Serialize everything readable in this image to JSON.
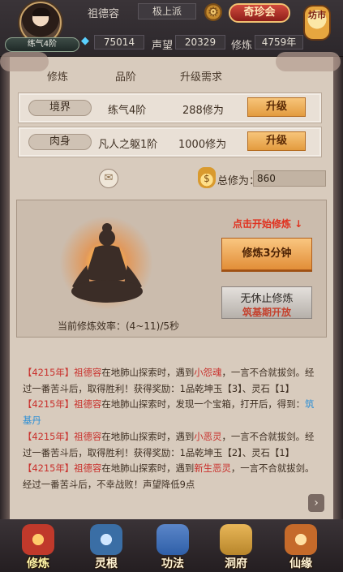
{
  "header": {
    "player_name": "祖德容",
    "sect": "极上派",
    "realm_badge": "练气4阶",
    "treasure_button": "奇珍会",
    "market_button": "坊市",
    "spirit_stones": "75014",
    "reputation_label": "声望",
    "reputation_value": "20329",
    "cultivation_label": "修炼",
    "cultivation_years": "4759年",
    "icons": {
      "settings": "gear-icon",
      "currency": "diamond-icon"
    }
  },
  "table": {
    "headers": [
      "修炼",
      "品阶",
      "升级需求"
    ],
    "rows": [
      {
        "label": "境界",
        "grade": "练气4阶",
        "requirement": "288修为",
        "button": "升级"
      },
      {
        "label": "肉身",
        "grade": "凡人之躯1阶",
        "requirement": "1000修为",
        "button": "升级"
      }
    ]
  },
  "total": {
    "label": "总修为：",
    "value": "860"
  },
  "stage": {
    "click_hint": "点击开始修炼 ↓",
    "cultivate_button": "修炼3分钟",
    "endless_button": "无休止修炼",
    "endless_note": "筑基期开放",
    "efficiency": "当前修炼效率：(4~11)/5秒"
  },
  "log": [
    {
      "year": "【4215年】",
      "name": "祖德容",
      "text1": "在地肺山探索时，遇到",
      "foe": "小怨魂",
      "text2": "，一言不合就拔剑。经过一番苦斗后，取得胜利！获得奖励：1品乾坤玉【3】、灵石【1】"
    },
    {
      "year": "【4215年】",
      "name": "祖德容",
      "text1": "在地肺山探索时，发现一个宝箱，打开后，得到：",
      "foe": "筑基丹",
      "text2": ""
    },
    {
      "year": "【4215年】",
      "name": "祖德容",
      "text1": "在地肺山探索时，遇到",
      "foe": "小恶灵",
      "text2": "，一言不合就拔剑。经过一番苦斗后，取得胜利！获得奖励：1品乾坤玉【2】、灵石【1】"
    },
    {
      "year": "【4215年】",
      "name": "祖德容",
      "text1": "在地肺山探索时，遇到",
      "foe": "新生恶灵",
      "text2": "，一言不合就拔剑。经过一番苦斗后，不幸战败！声望降低9点"
    }
  ],
  "nav": [
    {
      "label": "修炼",
      "icon": "cultivation-icon",
      "color": "#c0392b"
    },
    {
      "label": "灵根",
      "icon": "spirit-root-icon",
      "color": "#3a6ea5"
    },
    {
      "label": "功法",
      "icon": "technique-icon",
      "color": "#2f5fa8"
    },
    {
      "label": "洞府",
      "icon": "cave-icon",
      "color": "#b8862b"
    },
    {
      "label": "仙缘",
      "icon": "fate-icon",
      "color": "#c56a2a"
    }
  ]
}
